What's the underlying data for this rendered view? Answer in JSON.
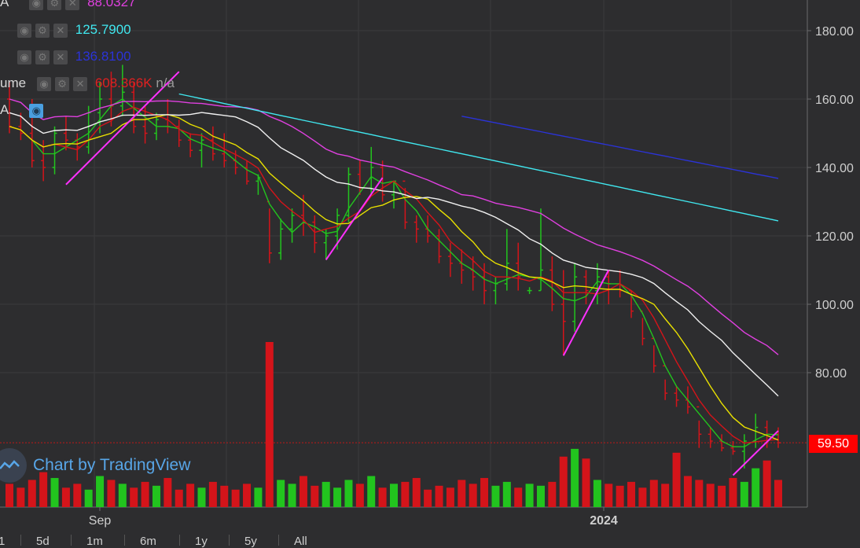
{
  "legend": [
    {
      "label": "A",
      "value": "88.0327",
      "color": "#e040e0",
      "eye": false
    },
    {
      "label": "",
      "value": "125.7900",
      "color": "#40e8f0",
      "eye": false
    },
    {
      "label": "",
      "value": "136.8100",
      "color": "#2b33d8",
      "eye": false
    },
    {
      "label": "ume",
      "value": "608.366K",
      "extra": "n/a",
      "color": "#e02020",
      "eye": false
    },
    {
      "label": "A",
      "value": "",
      "color": "#cccccc",
      "eye": true
    }
  ],
  "price_label": "59.50",
  "watermark": "Chart by TradingView",
  "ranges": [
    "1",
    "5d",
    "1m",
    "6m",
    "1y",
    "5y",
    "All"
  ],
  "colors": {
    "up": "#22c41e",
    "down": "#d4141a",
    "bg": "#2d2d2f",
    "grid": "#3a3a3c"
  },
  "chart_data": {
    "type": "line",
    "y_ticks": [
      "180.00",
      "160.00",
      "140.00",
      "120.00",
      "100.00",
      "80.00"
    ],
    "y_tick_values": [
      180,
      160,
      140,
      120,
      100,
      80
    ],
    "x_ticks": [
      "Sep",
      "2024"
    ],
    "ylim": [
      40,
      190
    ],
    "price_line": 59.5,
    "bars": [
      [
        160,
        165,
        150,
        152
      ],
      [
        152,
        156,
        148,
        150
      ],
      [
        150,
        160,
        140,
        142
      ],
      [
        142,
        148,
        136,
        140
      ],
      [
        140,
        152,
        138,
        150
      ],
      [
        150,
        155,
        145,
        148
      ],
      [
        148,
        150,
        142,
        146
      ],
      [
        146,
        158,
        144,
        156
      ],
      [
        156,
        165,
        150,
        160
      ],
      [
        160,
        168,
        152,
        158
      ],
      [
        158,
        170,
        155,
        162
      ],
      [
        162,
        165,
        150,
        152
      ],
      [
        152,
        158,
        147,
        150
      ],
      [
        150,
        156,
        148,
        154
      ],
      [
        154,
        160,
        150,
        152
      ],
      [
        152,
        154,
        146,
        148
      ],
      [
        148,
        150,
        143,
        145
      ],
      [
        145,
        150,
        140,
        148
      ],
      [
        148,
        152,
        142,
        144
      ],
      [
        144,
        150,
        140,
        142
      ],
      [
        142,
        145,
        138,
        140
      ],
      [
        140,
        142,
        135,
        136
      ],
      [
        136,
        138,
        132,
        137
      ],
      [
        130,
        128,
        112,
        115
      ],
      [
        115,
        125,
        113,
        122
      ],
      [
        122,
        128,
        118,
        126
      ],
      [
        126,
        132,
        120,
        124
      ],
      [
        124,
        126,
        115,
        118
      ],
      [
        118,
        122,
        113,
        120
      ],
      [
        120,
        128,
        116,
        126
      ],
      [
        126,
        140,
        124,
        138
      ],
      [
        138,
        142,
        132,
        134
      ],
      [
        134,
        146,
        132,
        140
      ],
      [
        140,
        142,
        130,
        132
      ],
      [
        132,
        136,
        128,
        136
      ],
      [
        136,
        134,
        122,
        124
      ],
      [
        124,
        126,
        118,
        122
      ],
      [
        122,
        126,
        118,
        120
      ],
      [
        120,
        122,
        112,
        114
      ],
      [
        114,
        118,
        108,
        112
      ],
      [
        112,
        116,
        106,
        110
      ],
      [
        110,
        114,
        104,
        108
      ],
      [
        108,
        112,
        100,
        104
      ],
      [
        104,
        108,
        100,
        106
      ],
      [
        106,
        122,
        104,
        112
      ],
      [
        112,
        118,
        104,
        108
      ],
      [
        104,
        105,
        103,
        104
      ],
      [
        104,
        128,
        104,
        110
      ],
      [
        110,
        114,
        98,
        100
      ],
      [
        100,
        110,
        85,
        95
      ],
      [
        95,
        112,
        92,
        108
      ],
      [
        108,
        110,
        100,
        104
      ],
      [
        104,
        112,
        100,
        108
      ],
      [
        108,
        110,
        100,
        106
      ],
      [
        106,
        110,
        102,
        104
      ],
      [
        104,
        104,
        96,
        98
      ],
      [
        98,
        96,
        88,
        90
      ],
      [
        90,
        88,
        80,
        82
      ],
      [
        82,
        78,
        72,
        74
      ],
      [
        74,
        76,
        70,
        72
      ],
      [
        72,
        76,
        68,
        70
      ],
      [
        70,
        66,
        58,
        62
      ],
      [
        62,
        64,
        58,
        60
      ],
      [
        60,
        62,
        57,
        58
      ],
      [
        58,
        60,
        56,
        57
      ],
      [
        57,
        62,
        52,
        60
      ],
      [
        60,
        68,
        58,
        64
      ],
      [
        64,
        66,
        58,
        62
      ],
      [
        62,
        64,
        58,
        59.5
      ]
    ],
    "volume": [
      12,
      10,
      14,
      18,
      15,
      10,
      12,
      9,
      16,
      14,
      12,
      10,
      13,
      11,
      15,
      9,
      12,
      10,
      13,
      11,
      9,
      12,
      10,
      85,
      14,
      12,
      16,
      11,
      13,
      10,
      14,
      12,
      16,
      10,
      12,
      13,
      15,
      9,
      11,
      10,
      14,
      12,
      15,
      11,
      13,
      10,
      12,
      11,
      13,
      26,
      30,
      25,
      14,
      12,
      11,
      13,
      10,
      14,
      12,
      28,
      16,
      14,
      12,
      11,
      15,
      13,
      20,
      24,
      14
    ],
    "series": [
      {
        "name": "",
        "color": "#e040e0",
        "values": []
      },
      {
        "name": "",
        "color": "#40e8f0",
        "values": []
      },
      {
        "name": "",
        "color": "#2b33d8",
        "values": []
      },
      {
        "name": "",
        "color": "#f0f0f0",
        "values": []
      },
      {
        "name": "",
        "color": "#e8e000",
        "values": []
      },
      {
        "name": "",
        "color": "#d4141a",
        "values": []
      },
      {
        "name": "",
        "color": "#22c41e",
        "values": []
      }
    ]
  }
}
